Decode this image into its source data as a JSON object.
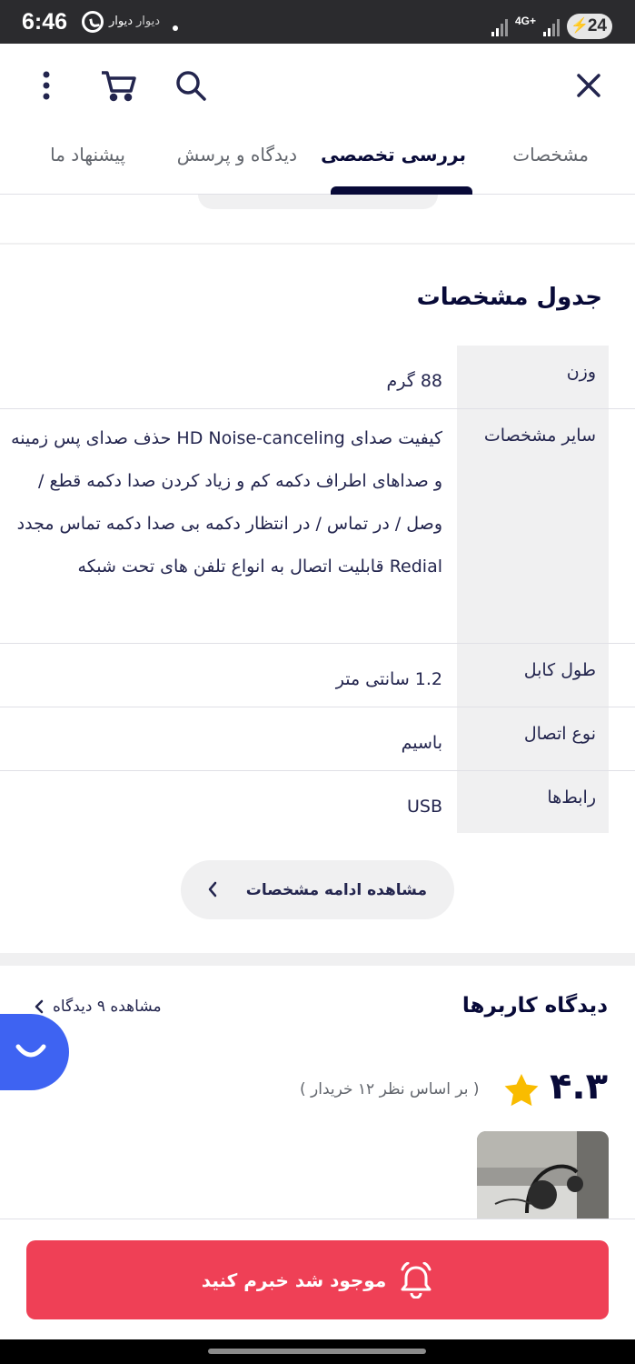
{
  "status_bar": {
    "time": "6:46",
    "app_label_1": "دیوار",
    "app_label_2": "دیوار",
    "network": "4G+",
    "battery": "24"
  },
  "tabs": [
    "مشخصات",
    "بررسی تخصصی",
    "دیدگاه و پرسش",
    "پیشنهاد ما"
  ],
  "active_tab": "بررسی تخصصی",
  "specs": {
    "title": "جدول مشخصات",
    "rows": [
      {
        "key": "وزن",
        "value": "88 گرم"
      },
      {
        "key": "سایر مشخصات",
        "value": "کیفیت صدای HD Noise-canceling حذف صدای پس زمینه و صداهای اطراف دکمه کم و زیاد کردن صدا دکمه قطع / وصل / در تماس / در انتظار دکمه بی صدا دکمه تماس مجدد Redial قابلیت اتصال به انواع تلفن های تحت شبکه"
      },
      {
        "key": "طول کابل",
        "value": "1.2 سانتی متر"
      },
      {
        "key": "نوع اتصال",
        "value": "باسیم"
      },
      {
        "key": "رابط‌ها",
        "value": "USB"
      }
    ],
    "more_label": "مشاهده ادامه مشخصات"
  },
  "reviews": {
    "title": "دیدگاه کاربرها",
    "see_all": "مشاهده ۹ دیدگاه",
    "rating": "۴.۳",
    "based_on": "( بر اساس نظر ۱۲ خریدار )"
  },
  "notify_button": "موجود شد خبرم کنید",
  "colors": {
    "primary_text": "#080a38",
    "accent_red": "#ef4056",
    "chat_blue": "#3e63f2",
    "star": "#f9bc00"
  }
}
